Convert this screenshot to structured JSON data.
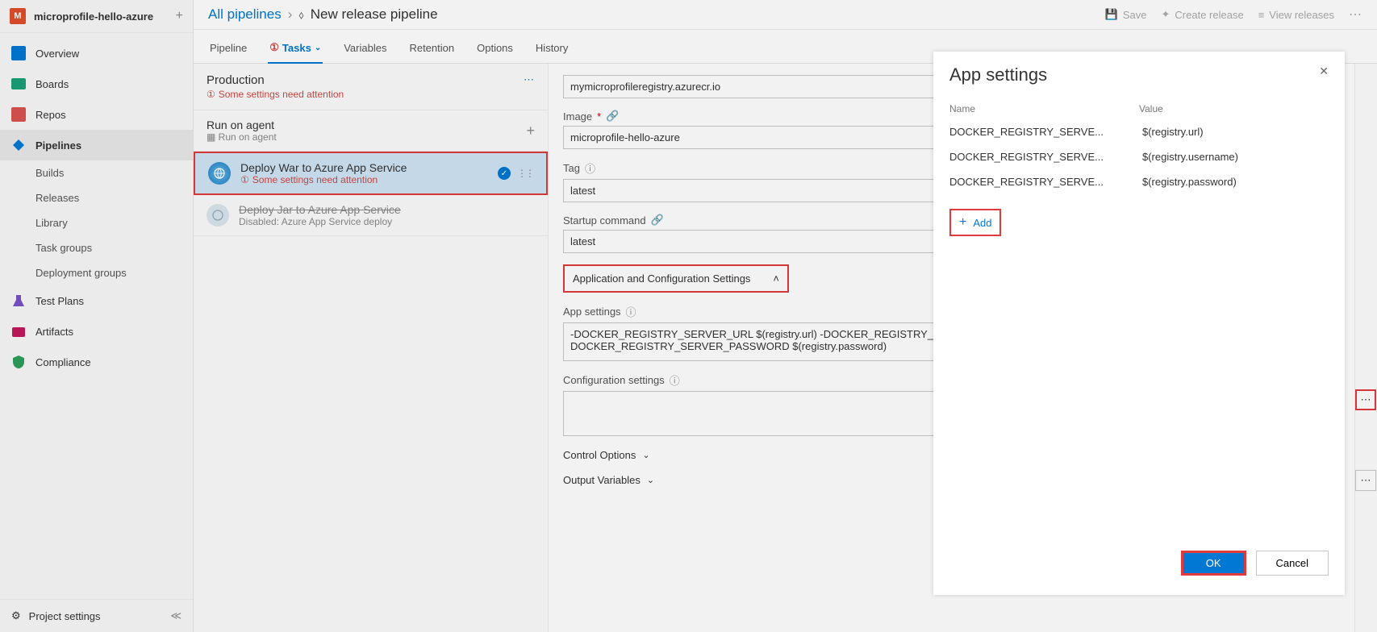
{
  "project": {
    "initial": "M",
    "name": "microprofile-hello-azure"
  },
  "sidebar": {
    "items": [
      {
        "label": "Overview",
        "icon": "overview-icon"
      },
      {
        "label": "Boards",
        "icon": "boards-icon"
      },
      {
        "label": "Repos",
        "icon": "repos-icon"
      },
      {
        "label": "Pipelines",
        "icon": "pipelines-icon",
        "active": true
      },
      {
        "label": "Test Plans",
        "icon": "testplans-icon"
      },
      {
        "label": "Artifacts",
        "icon": "artifacts-icon"
      },
      {
        "label": "Compliance",
        "icon": "compliance-icon"
      }
    ],
    "subitems": [
      "Builds",
      "Releases",
      "Library",
      "Task groups",
      "Deployment groups"
    ],
    "footer": "Project settings"
  },
  "breadcrumb": {
    "root": "All pipelines",
    "title": "New release pipeline"
  },
  "header_actions": {
    "save": "Save",
    "create": "Create release",
    "view": "View releases"
  },
  "tabs": [
    "Pipeline",
    "Tasks",
    "Variables",
    "Retention",
    "Options",
    "History"
  ],
  "stage": {
    "name": "Production",
    "warn": "Some settings need attention"
  },
  "tasks": {
    "agent": {
      "title": "Run on agent",
      "sub": "Run on agent"
    },
    "active": {
      "title": "Deploy War to Azure App Service",
      "warn": "Some settings need attention"
    },
    "disabled": {
      "title": "Deploy Jar to Azure App Service",
      "sub": "Disabled: Azure App Service deploy"
    }
  },
  "form": {
    "registry_value": "mymicroprofileregistry.azurecr.io",
    "image_label": "Image",
    "image_value": "microprofile-hello-azure",
    "tag_label": "Tag",
    "tag_value": "latest",
    "startup_label": "Startup command",
    "startup_value": "latest",
    "section": "Application and Configuration Settings",
    "appsettings_label": "App settings",
    "appsettings_value": "-DOCKER_REGISTRY_SERVER_URL $(registry.url) -DOCKER_REGISTRY_SERVER_USERNAME $(registry.username) -DOCKER_REGISTRY_SERVER_PASSWORD $(registry.password)",
    "configsettings_label": "Configuration settings",
    "control_options": "Control Options",
    "output_vars": "Output Variables"
  },
  "panel": {
    "title": "App settings",
    "col1": "Name",
    "col2": "Value",
    "rows": [
      {
        "name": "DOCKER_REGISTRY_SERVE...",
        "value": "$(registry.url)"
      },
      {
        "name": "DOCKER_REGISTRY_SERVE...",
        "value": "$(registry.username)"
      },
      {
        "name": "DOCKER_REGISTRY_SERVE...",
        "value": "$(registry.password)"
      }
    ],
    "add": "Add",
    "ok": "OK",
    "cancel": "Cancel"
  }
}
